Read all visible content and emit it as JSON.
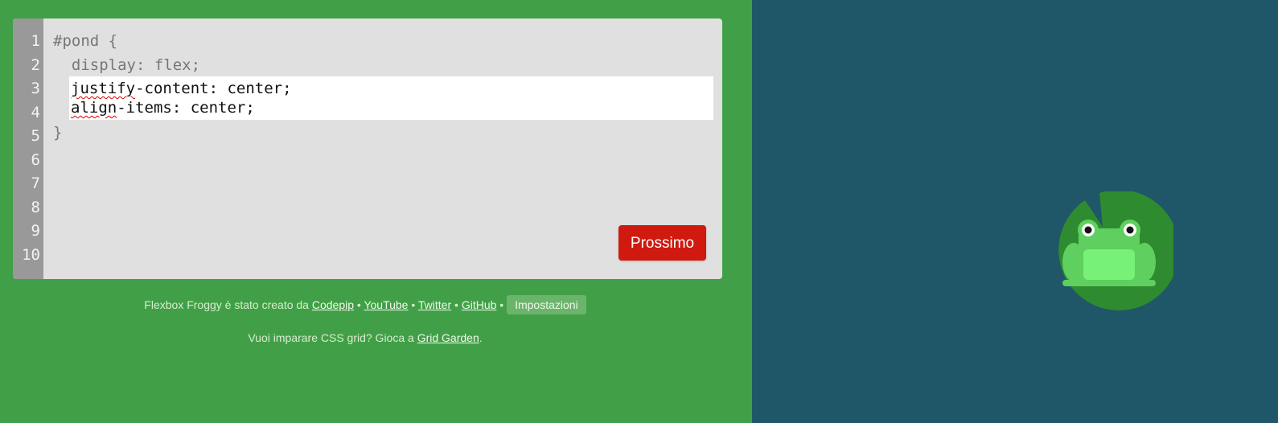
{
  "editor": {
    "line_numbers": [
      "1",
      "2",
      "3",
      "4",
      "5",
      "6",
      "7",
      "8",
      "9",
      "10"
    ],
    "code_lines": {
      "line1": "#pond {",
      "line2": "  display: flex;",
      "line5": "}"
    },
    "input_lines": {
      "line3_prop": "justify",
      "line3_rest": "-content: center;",
      "line4_prop": "align",
      "line4_rest": "-items: center;"
    },
    "next_button": "Prossimo"
  },
  "footer": {
    "credit_text": "Flexbox Froggy è stato creato da",
    "links": {
      "codepip": "Codepip",
      "youtube": "YouTube",
      "twitter": "Twitter",
      "github": "GitHub"
    },
    "separator": "•",
    "settings": "Impostazioni",
    "grid_prefix": "Vuoi imparare CSS grid? Gioca a",
    "grid_link": "Grid Garden",
    "grid_suffix": "."
  },
  "colors": {
    "left_background": "#41a047",
    "right_background": "#1f5768",
    "editor_background": "#e0e0e0",
    "gutter": "#999999",
    "button": "#d0190f",
    "lilypad": "#2f8b2f",
    "frog_body": "#5fd05f",
    "frog_belly": "#78f178"
  },
  "icons": {
    "frog": "frog-icon",
    "lilypad": "lilypad-icon"
  }
}
